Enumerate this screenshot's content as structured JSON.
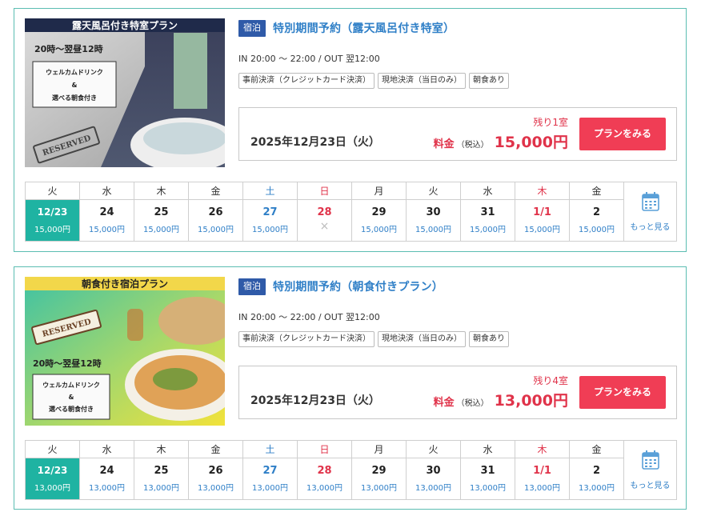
{
  "colors": {
    "accent_teal": "#1fb3a2",
    "border_teal": "#5bbdb2",
    "link_blue": "#2f7fc7",
    "badge_blue": "#2f5aa8",
    "price_red": "#e0334a",
    "button_red": "#f03d55"
  },
  "plans": [
    {
      "thumb": {
        "banner": "露天風呂付き特室プラン",
        "time": "20時～翌昼12時",
        "welcome_line1": "ウェルカムドリンク",
        "welcome_amp": "&",
        "welcome_line2": "選べる朝食付き",
        "stamp": "RESERVED"
      },
      "type_badge": "宿泊",
      "title": "特別期間予約（露天風呂付き特室）",
      "checkin": "IN 20:00 ～ 22:00 / OUT 翌12:00",
      "tags": [
        "事前決済（クレジットカード決済）",
        "現地決済（当日のみ）",
        "朝食あり"
      ],
      "date": "2025年12月23日（火）",
      "remaining": "残り1室",
      "price_label": "料金",
      "tax_label": "（税込）",
      "price": "15,000円",
      "cta": "プランをみる",
      "calendar": [
        {
          "dow": "火",
          "day": "12/23",
          "price": "15,000円",
          "state": "selected"
        },
        {
          "dow": "水",
          "day": "24",
          "price": "15,000円",
          "state": "weekday"
        },
        {
          "dow": "木",
          "day": "25",
          "price": "15,000円",
          "state": "weekday"
        },
        {
          "dow": "金",
          "day": "26",
          "price": "15,000円",
          "state": "weekday"
        },
        {
          "dow": "土",
          "day": "27",
          "price": "15,000円",
          "state": "sat"
        },
        {
          "dow": "日",
          "day": "28",
          "price": "×",
          "state": "sun-unavailable"
        },
        {
          "dow": "月",
          "day": "29",
          "price": "15,000円",
          "state": "weekday"
        },
        {
          "dow": "火",
          "day": "30",
          "price": "15,000円",
          "state": "weekday"
        },
        {
          "dow": "水",
          "day": "31",
          "price": "15,000円",
          "state": "weekday"
        },
        {
          "dow": "木",
          "day": "1/1",
          "price": "15,000円",
          "state": "holiday"
        },
        {
          "dow": "金",
          "day": "2",
          "price": "15,000円",
          "state": "weekday"
        }
      ],
      "more_label": "もっと見る",
      "more_icon": "calendar-icon"
    },
    {
      "thumb": {
        "banner": "朝食付き宿泊プラン",
        "time": "20時～翌昼12時",
        "welcome_line1": "ウェルカムドリンク",
        "welcome_amp": "&",
        "welcome_line2": "選べる朝食付き",
        "stamp": "RESERVED"
      },
      "type_badge": "宿泊",
      "title": "特別期間予約（朝食付きプラン）",
      "checkin": "IN 20:00 ～ 22:00 / OUT 翌12:00",
      "tags": [
        "事前決済（クレジットカード決済）",
        "現地決済（当日のみ）",
        "朝食あり"
      ],
      "date": "2025年12月23日（火）",
      "remaining": "残り4室",
      "price_label": "料金",
      "tax_label": "（税込）",
      "price": "13,000円",
      "cta": "プランをみる",
      "calendar": [
        {
          "dow": "火",
          "day": "12/23",
          "price": "13,000円",
          "state": "selected"
        },
        {
          "dow": "水",
          "day": "24",
          "price": "13,000円",
          "state": "weekday"
        },
        {
          "dow": "木",
          "day": "25",
          "price": "13,000円",
          "state": "weekday"
        },
        {
          "dow": "金",
          "day": "26",
          "price": "13,000円",
          "state": "weekday"
        },
        {
          "dow": "土",
          "day": "27",
          "price": "13,000円",
          "state": "sat"
        },
        {
          "dow": "日",
          "day": "28",
          "price": "13,000円",
          "state": "sun"
        },
        {
          "dow": "月",
          "day": "29",
          "price": "13,000円",
          "state": "weekday"
        },
        {
          "dow": "火",
          "day": "30",
          "price": "13,000円",
          "state": "weekday"
        },
        {
          "dow": "水",
          "day": "31",
          "price": "13,000円",
          "state": "weekday"
        },
        {
          "dow": "木",
          "day": "1/1",
          "price": "13,000円",
          "state": "holiday"
        },
        {
          "dow": "金",
          "day": "2",
          "price": "13,000円",
          "state": "weekday"
        }
      ],
      "more_label": "もっと見る",
      "more_icon": "calendar-icon"
    }
  ]
}
